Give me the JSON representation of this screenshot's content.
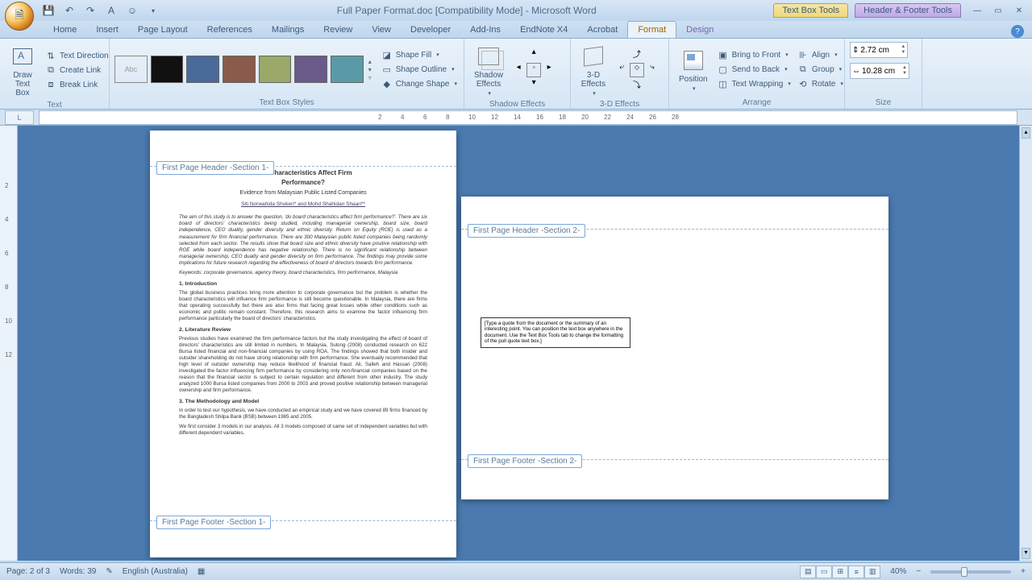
{
  "title": "Full Paper Format.doc [Compatibility Mode] - Microsoft Word",
  "context_tabs": {
    "textbox": "Text Box Tools",
    "header": "Header & Footer Tools"
  },
  "tabs": [
    "Home",
    "Insert",
    "Page Layout",
    "References",
    "Mailings",
    "Review",
    "View",
    "Developer",
    "Add-Ins",
    "EndNote X4",
    "Acrobat",
    "Format",
    "Design"
  ],
  "active_tab": "Format",
  "groups": {
    "text": {
      "label": "Text",
      "draw": "Draw\nText Box",
      "direction": "Text Direction",
      "createlink": "Create Link",
      "breaklink": "Break Link"
    },
    "styles": {
      "label": "Text Box Styles",
      "colors": [
        "#111111",
        "#4a6a9a",
        "#8a5a4a",
        "#9aa86a",
        "#6a5a8a",
        "#5a9aa8"
      ],
      "fill": "Shape Fill",
      "outline": "Shape Outline",
      "change": "Change Shape"
    },
    "shadow": {
      "label": "Shadow Effects",
      "btn": "Shadow\nEffects"
    },
    "threed": {
      "label": "3-D Effects",
      "btn": "3-D\nEffects"
    },
    "arrange": {
      "label": "Arrange",
      "position": "Position",
      "bringfront": "Bring to Front",
      "sendback": "Send to Back",
      "wrap": "Text Wrapping",
      "align": "Align",
      "group": "Group",
      "rotate": "Rotate"
    },
    "size": {
      "label": "Size",
      "height": "2.72 cm",
      "width": "10.28 cm"
    }
  },
  "ruler_ticks": [
    "2",
    "4",
    "6",
    "8",
    "10",
    "12",
    "14",
    "16",
    "18",
    "20",
    "22",
    "24",
    "26",
    "28"
  ],
  "vruler_ticks": [
    "2",
    "4",
    "6",
    "8",
    "10",
    "12"
  ],
  "page1": {
    "header_tag": "First Page Header -Section 1-",
    "footer_tag": "First Page Footer -Section 1-",
    "title_l1": "tor's Characteristics Affect Firm",
    "title_l2": "Performance?",
    "subtitle": "Evidence from Malaysian Public Listed Companies",
    "authors": "Siti Norwahida Shukeri* and Mohd Shahidan Shaari**",
    "abstract": "The aim of this study is to answer the question, 'do board characteristics affect firm performance?'. There are six board of directors' characteristics being studied, including managerial ownership, board size, board independence, CEO duality, gender diversity and ethnic diversity. Return on Equity (ROE) is used as a measurement for firm financial performance. There are 300 Malaysian public listed companies being randomly selected from each sector. The results show that board size and ethnic diversity have positive relationship with ROE while board independence has negative relationship. There is no significant relationship between managerial ownership, CEO duality and gender diversity on firm performance. The findings may provide some implications for future research regarding the effectiveness of board of directors towards firm performance.",
    "keywords": "Keywords: corporate governance, agency theory, board characteristics, firm performance, Malaysia",
    "sect1": "1. Introduction",
    "intro": "The global business practices bring more attention to corporate governance but the problem is whether the board characteristics will influence firm performance is still become questionable. In Malaysia, there are firms that operating successfully but there are also firms that facing great losses while other conditions such as economic and politic remain constant. Therefore, this research aims to examine the factor influencing firm performance particularly the board of directors' characteristics.",
    "sect2": "2. Literature Review",
    "lit": "Previous studies have examined the firm performance factors but the study investigating the effect of board of directors' characteristics are still limited in numbers. In Malaysia, Sulong (2008) conducted research on 622 Bursa listed financial and non-financial companies by using ROA. The findings showed that both insider and outsider shareholding do not have strong relationship with firm performance. She eventually recommended that high level of outsider ownership may reduce likelihood of financial fraud. Ali, Salleh and Hassan (2008) investigated the factor influencing firm performance by considering only non-financial companies based on the reason that the financial sector is subject to certain regulation and different from other industry. The study analyzed 1000 Bursa listed companies from 2000 to 2003 and proved positive relationship between managerial ownership and firm performance.",
    "sect3": "3. The Methodology and Model",
    "meth1": "In order to test our hypothesis, we have conducted an empirical study and we have covered 89 firms financed by the Bangladesh Shilpa Bank (BSB) between 1985 and 2005.",
    "meth2": "We first consider 3 models in our analysis. All 3 models composed of same set of  independent  variables  but  with  different  dependent  variables."
  },
  "page2": {
    "header_tag": "First Page Header -Section 2-",
    "footer_tag": "First Page Footer -Section 2-",
    "textbox": "[Type a quote from the document or the summary of an interesting point. You can position the text box anywhere in the document. Use the Text Box Tools tab to change the formatting of the pull quote text box.]"
  },
  "status": {
    "page": "Page: 2 of 3",
    "words": "Words: 39",
    "lang": "English (Australia)",
    "zoom": "40%"
  }
}
